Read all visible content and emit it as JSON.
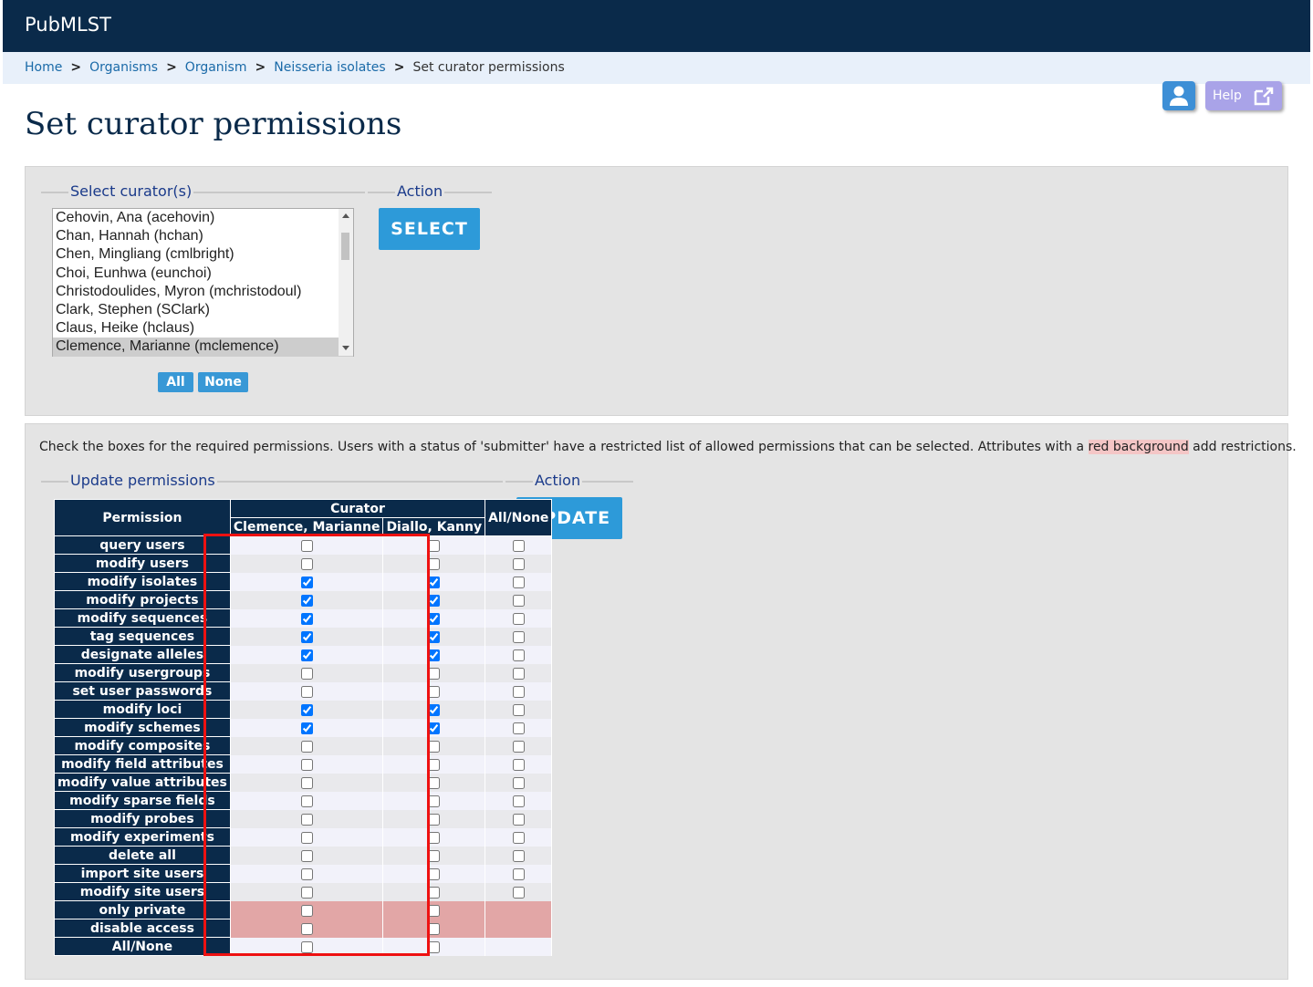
{
  "app": {
    "brand": "PubMLST"
  },
  "breadcrumb": {
    "items": [
      "Home",
      "Organisms",
      "Organism",
      "Neisseria isolates"
    ],
    "current": "Set curator permissions",
    "separator": ">"
  },
  "header": {
    "help_label": "Help"
  },
  "page": {
    "title": "Set curator permissions"
  },
  "select_section": {
    "legend": "Select curator(s)",
    "action_legend": "Action",
    "select_button": "SELECT",
    "all_button": "All",
    "none_button": "None",
    "curators": [
      "Cehovin, Ana (acehovin)",
      "Chan, Hannah (hchan)",
      "Chen, Mingliang (cmlbright)",
      "Choi, Eunhwa (eunchoi)",
      "Christodoulides, Myron (mchristodoul)",
      "Clark, Stephen (SClark)",
      "Claus, Heike (hclaus)",
      "Clemence, Marianne (mclemence)"
    ],
    "selected": "Clemence, Marianne (mclemence)"
  },
  "update_section": {
    "info_text_before": "Check the boxes for the required permissions. Users with a status of 'submitter' have a restricted list of allowed permissions that can be selected. Attributes with a ",
    "info_text_red": "red background",
    "info_text_after": " add restrictions.",
    "legend": "Update permissions",
    "action_legend": "Action",
    "update_button": "UPDATE",
    "table": {
      "permission_header": "Permission",
      "curator_header": "Curator",
      "all_none_header": "All/None",
      "curators": [
        "Clemence, Marianne",
        "Diallo, Kanny"
      ],
      "rows": [
        {
          "label": "query users",
          "values": [
            false,
            false
          ],
          "has_all_none": true,
          "restricted": false
        },
        {
          "label": "modify users",
          "values": [
            false,
            false
          ],
          "has_all_none": true,
          "restricted": false
        },
        {
          "label": "modify isolates",
          "values": [
            true,
            true
          ],
          "has_all_none": true,
          "restricted": false
        },
        {
          "label": "modify projects",
          "values": [
            true,
            true
          ],
          "has_all_none": true,
          "restricted": false
        },
        {
          "label": "modify sequences",
          "values": [
            true,
            true
          ],
          "has_all_none": true,
          "restricted": false
        },
        {
          "label": "tag sequences",
          "values": [
            true,
            true
          ],
          "has_all_none": true,
          "restricted": false
        },
        {
          "label": "designate alleles",
          "values": [
            true,
            true
          ],
          "has_all_none": true,
          "restricted": false
        },
        {
          "label": "modify usergroups",
          "values": [
            false,
            false
          ],
          "has_all_none": true,
          "restricted": false
        },
        {
          "label": "set user passwords",
          "values": [
            false,
            false
          ],
          "has_all_none": true,
          "restricted": false
        },
        {
          "label": "modify loci",
          "values": [
            true,
            true
          ],
          "has_all_none": true,
          "restricted": false
        },
        {
          "label": "modify schemes",
          "values": [
            true,
            true
          ],
          "has_all_none": true,
          "restricted": false
        },
        {
          "label": "modify composites",
          "values": [
            false,
            false
          ],
          "has_all_none": true,
          "restricted": false
        },
        {
          "label": "modify field attributes",
          "values": [
            false,
            false
          ],
          "has_all_none": true,
          "restricted": false
        },
        {
          "label": "modify value attributes",
          "values": [
            false,
            false
          ],
          "has_all_none": true,
          "restricted": false
        },
        {
          "label": "modify sparse fields",
          "values": [
            false,
            false
          ],
          "has_all_none": true,
          "restricted": false
        },
        {
          "label": "modify probes",
          "values": [
            false,
            false
          ],
          "has_all_none": true,
          "restricted": false
        },
        {
          "label": "modify experiments",
          "values": [
            false,
            false
          ],
          "has_all_none": true,
          "restricted": false
        },
        {
          "label": "delete all",
          "values": [
            false,
            false
          ],
          "has_all_none": true,
          "restricted": false
        },
        {
          "label": "import site users",
          "values": [
            false,
            false
          ],
          "has_all_none": true,
          "restricted": false
        },
        {
          "label": "modify site users",
          "values": [
            false,
            false
          ],
          "has_all_none": true,
          "restricted": false
        },
        {
          "label": "only private",
          "values": [
            false,
            false
          ],
          "has_all_none": false,
          "restricted": true
        },
        {
          "label": "disable access",
          "values": [
            false,
            false
          ],
          "has_all_none": false,
          "restricted": true
        },
        {
          "label": "All/None",
          "values": [
            false,
            false
          ],
          "has_all_none": false,
          "restricted": false
        }
      ]
    }
  },
  "colors": {
    "nav": "#0a2a4a",
    "breadcrumb_bg": "#e8f0fa",
    "button": "#2d9ad9",
    "restricted": "#e2a6a6",
    "highlight": "#ee1111"
  }
}
